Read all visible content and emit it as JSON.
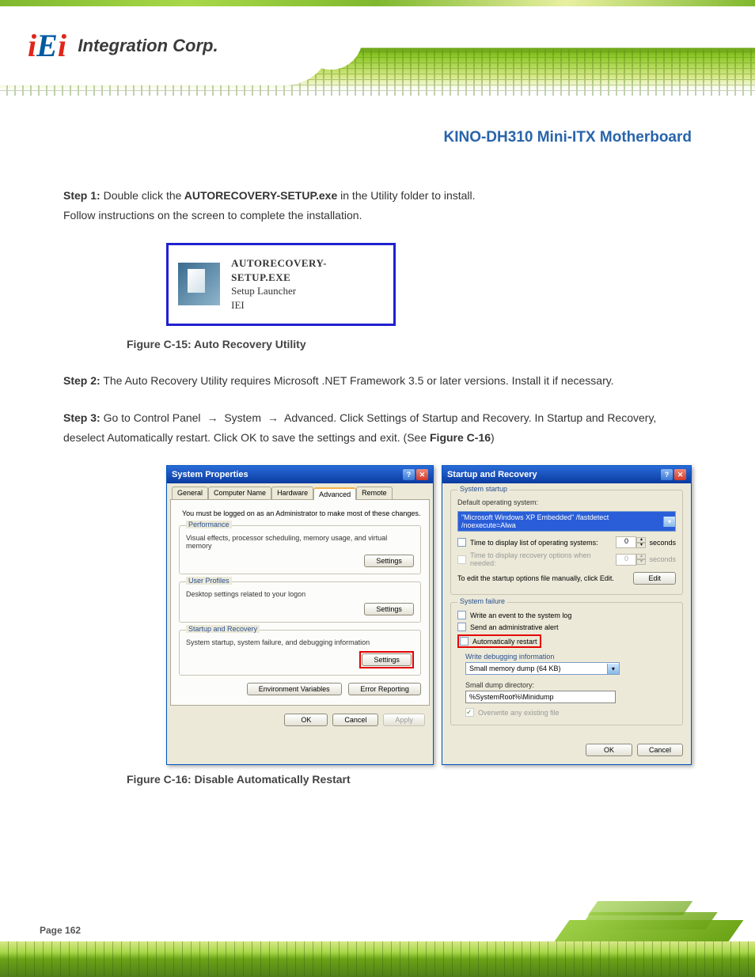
{
  "header": {
    "logo_integration": "Integration Corp."
  },
  "doc": {
    "title": "KINO-DH310 Mini-ITX Motherboard"
  },
  "steps": {
    "s1_label": "Step 1:",
    "s1_text": " Double click the",
    "s1_exe_text": " AUTORECOVERY-SETUP.exe ",
    "s1_rest": "in the Utility folder to install.",
    "s1_follow": "Follow instructions on the screen to complete the installation.",
    "s2_label": "Step 2:",
    "s2_text": " The Auto Recovery Utility requires Microsoft .NET Framework 3.5 or later versions. Install it if necessary.",
    "s3_label": "Step 3:",
    "s3_text": " Go to Control Panel ",
    "s3_text2": " System ",
    "s3_text3": " Advanced. Click Settings of Startup and Recovery. In Startup and Recovery, deselect Automatically restart. Click OK to save the settings and exit. (See ",
    "s3_fig": "Figure C-16",
    "s3_end": ")",
    "arrow_glyph": "→"
  },
  "figure_setup": {
    "exe_name": "AUTORECOVERY-SETUP.EXE",
    "line2": "Setup Launcher",
    "line3": "IEI",
    "caption": "Figure C-15: Auto Recovery Utility"
  },
  "dialog1": {
    "title": "System Properties",
    "tabs": [
      "General",
      "Computer Name",
      "Hardware",
      "Advanced",
      "Remote"
    ],
    "note": "You must be logged on as an Administrator to make most of these changes.",
    "perf_title": "Performance",
    "perf_desc": "Visual effects, processor scheduling, memory usage, and virtual memory",
    "up_title": "User Profiles",
    "up_desc": "Desktop settings related to your logon",
    "sr_title": "Startup and Recovery",
    "sr_desc": "System startup, system failure, and debugging information",
    "btn_settings": "Settings",
    "btn_env": "Environment Variables",
    "btn_err": "Error Reporting",
    "btn_ok": "OK",
    "btn_cancel": "Cancel",
    "btn_apply": "Apply"
  },
  "dialog2": {
    "title": "Startup and Recovery",
    "ss_title": "System startup",
    "ss_default": "Default operating system:",
    "ss_combo": "\"Microsoft Windows XP Embedded\" /fastdetect /noexecute=Alwa",
    "ss_time1": "Time to display list of operating systems:",
    "ss_time2": "Time to display recovery options when needed:",
    "ss_spin": "0",
    "ss_sec": "seconds",
    "ss_edit": "To edit the startup options file manually, click Edit.",
    "btn_edit": "Edit",
    "sf_title": "System failure",
    "sf_cb1": "Write an event to the system log",
    "sf_cb2": "Send an administrative alert",
    "sf_cb3": "Automatically restart",
    "sf_wdi": "Write debugging information",
    "sf_combo": "Small memory dump (64 KB)",
    "sf_dir": "Small dump directory:",
    "sf_path": "%SystemRoot%\\Minidump",
    "sf_ovw": "Overwrite any existing file",
    "btn_ok": "OK",
    "btn_cancel": "Cancel"
  },
  "fig16_caption": "Figure C-16: Disable Automatically Restart",
  "footer": {
    "page_label": "Page 162"
  }
}
